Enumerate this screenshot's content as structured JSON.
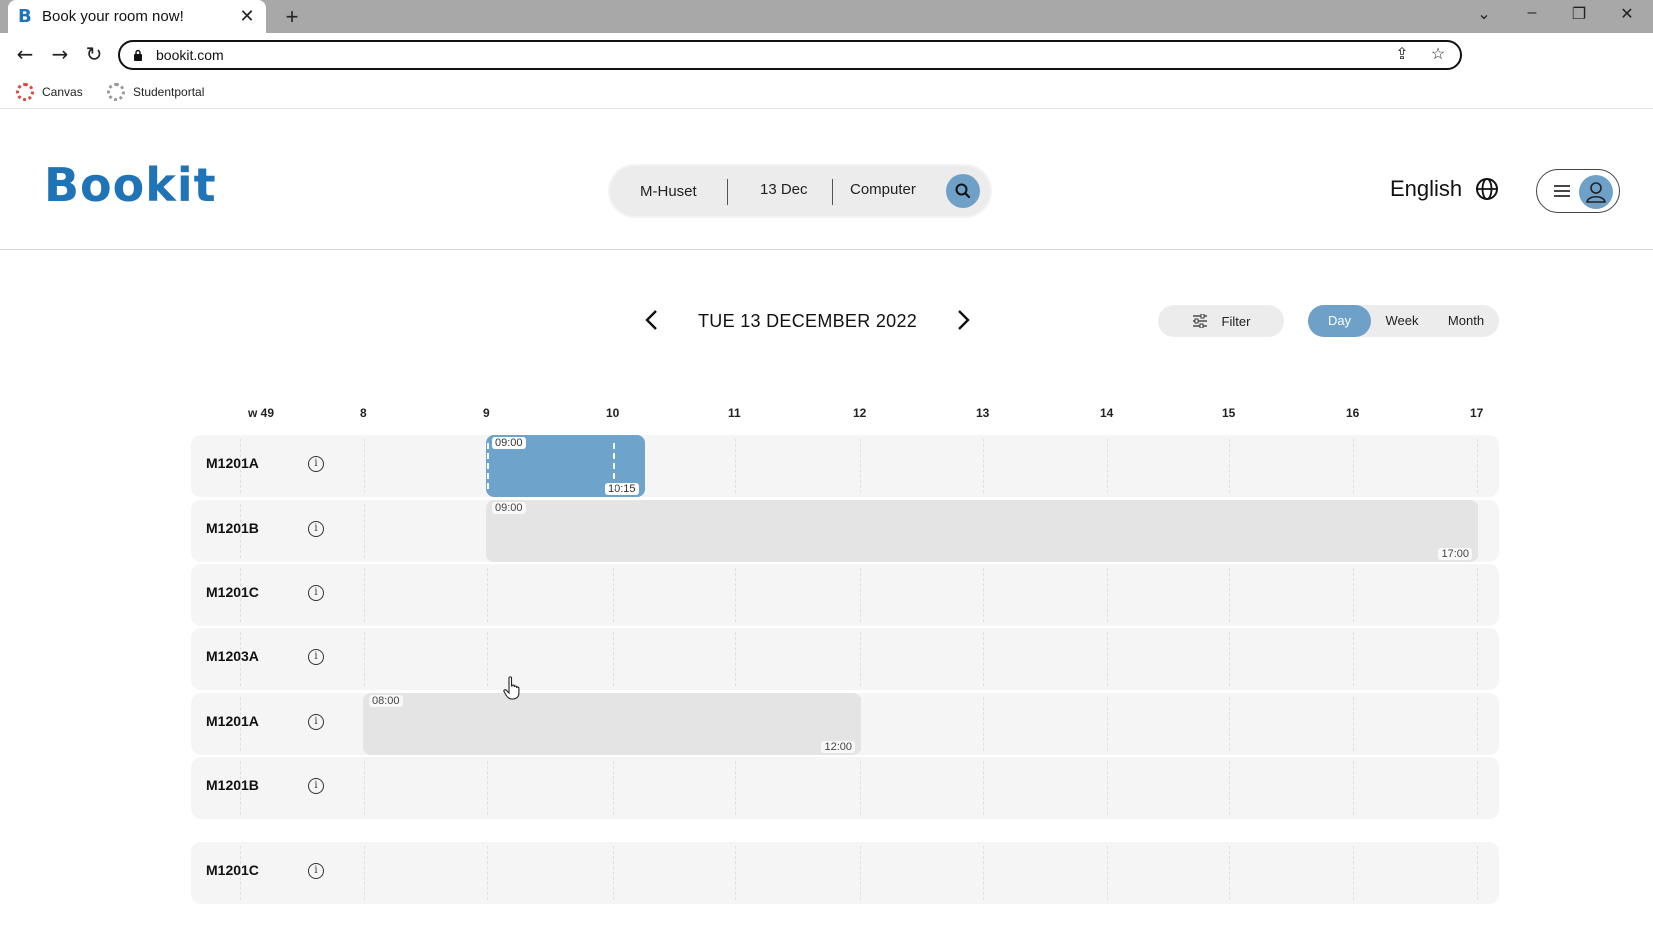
{
  "browser": {
    "tab_title": "Book your room now!",
    "tab_favicon": "B",
    "url": "bookit.com",
    "bookmarks": [
      {
        "label": "Canvas",
        "icon": "canvas-icon",
        "color": "#e0473b"
      },
      {
        "label": "Studentportal",
        "icon": "studentportal-icon",
        "color": "#9a9a9a"
      }
    ]
  },
  "header": {
    "logo": "Bookit",
    "search": {
      "location": "M-Huset",
      "date": "13 Dec",
      "room_type": "Computer"
    },
    "language": "English"
  },
  "datenav": {
    "date_label": "TUE 13 DECEMBER 2022",
    "filter_label": "Filter",
    "views": [
      "Day",
      "Week",
      "Month"
    ],
    "active_view": "Day"
  },
  "timeline": {
    "week_label": "w 49",
    "hours": [
      "8",
      "9",
      "10",
      "11",
      "12",
      "13",
      "14",
      "15",
      "16",
      "17"
    ],
    "rooms": [
      {
        "name": "M1201A",
        "bookings": [
          {
            "start": "09:00",
            "end": "10:15",
            "style": "selected"
          }
        ]
      },
      {
        "name": "M1201B",
        "bookings": [
          {
            "start": "09:00",
            "end": "17:00",
            "style": "booked"
          }
        ]
      },
      {
        "name": "M1201C",
        "bookings": []
      },
      {
        "name": "M1203A",
        "bookings": []
      },
      {
        "name": "M1201A",
        "bookings": [
          {
            "start": "08:00",
            "end": "12:00",
            "style": "booked"
          }
        ]
      },
      {
        "name": "M1201B",
        "bookings": []
      },
      {
        "name": "M1201C",
        "bookings": []
      }
    ]
  },
  "colors": {
    "brand": "#1f73b7",
    "accent": "#6ea0c8",
    "booked": "#e4e4e4",
    "selected": "#6ea4cc"
  }
}
